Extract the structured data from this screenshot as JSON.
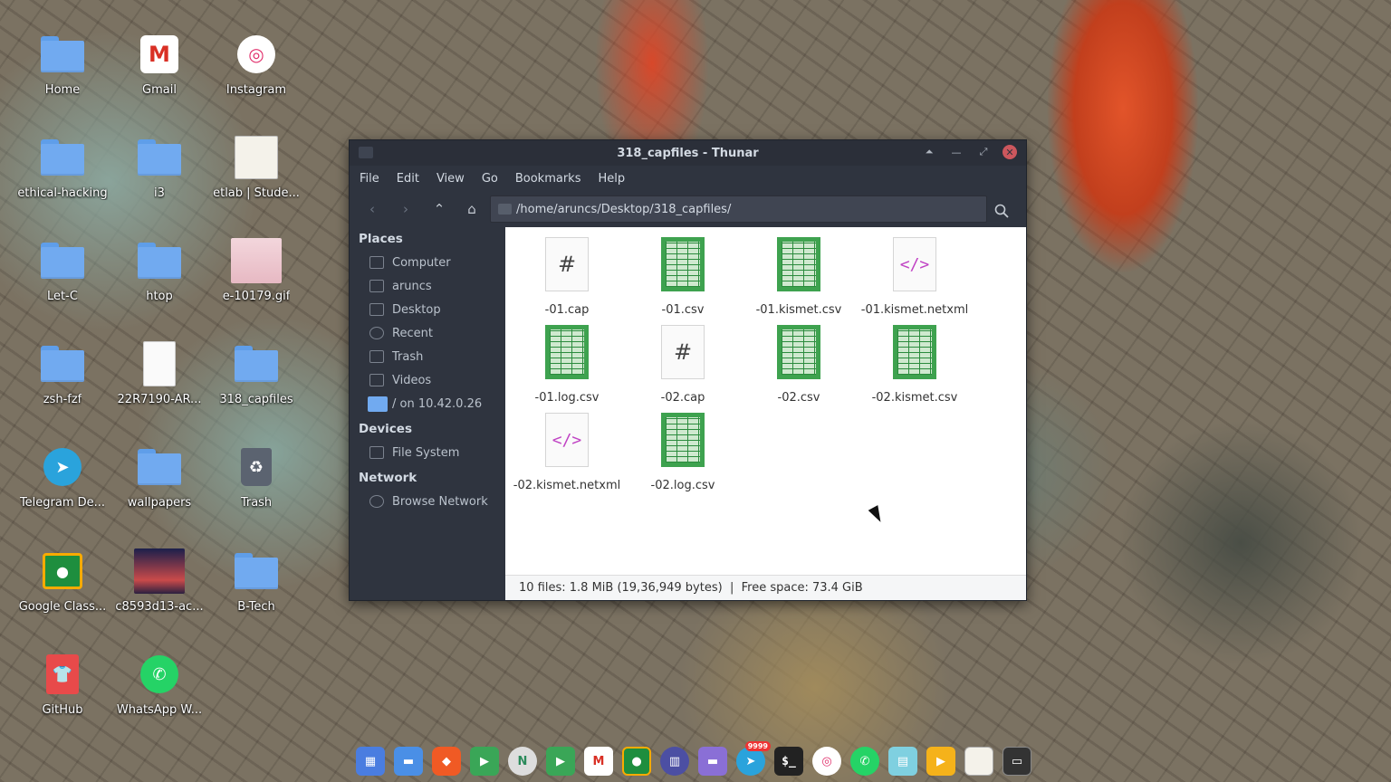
{
  "desktop": {
    "icons": [
      {
        "label": "Home"
      },
      {
        "label": "Gmail"
      },
      {
        "label": "Instagram"
      },
      {
        "label": "ethical-hacking"
      },
      {
        "label": "i3"
      },
      {
        "label": "etlab | Stude..."
      },
      {
        "label": "Let-C"
      },
      {
        "label": "htop"
      },
      {
        "label": "e-10179.gif"
      },
      {
        "label": "zsh-fzf"
      },
      {
        "label": "22R7190-AR..."
      },
      {
        "label": "318_capfiles"
      },
      {
        "label": "Telegram De..."
      },
      {
        "label": "wallpapers"
      },
      {
        "label": "Trash"
      },
      {
        "label": "Google Class..."
      },
      {
        "label": "c8593d13-ac..."
      },
      {
        "label": "B-Tech"
      },
      {
        "label": "GitHub"
      },
      {
        "label": "WhatsApp W..."
      }
    ]
  },
  "window": {
    "title": "318_capfiles - Thunar",
    "menu": [
      "File",
      "Edit",
      "View",
      "Go",
      "Bookmarks",
      "Help"
    ],
    "path": "/home/aruncs/Desktop/318_capfiles/",
    "sidebar": {
      "places_header": "Places",
      "places": [
        {
          "label": "Computer",
          "icon": "computer-icon"
        },
        {
          "label": "aruncs",
          "icon": "home-icon"
        },
        {
          "label": "Desktop",
          "icon": "desktop-icon"
        },
        {
          "label": "Recent",
          "icon": "recent-icon"
        },
        {
          "label": "Trash",
          "icon": "trash-icon"
        },
        {
          "label": "Videos",
          "icon": "videos-icon"
        },
        {
          "label": "/ on 10.42.0.26",
          "icon": "network-folder-icon"
        }
      ],
      "devices_header": "Devices",
      "devices": [
        {
          "label": "File System",
          "icon": "drive-icon"
        }
      ],
      "network_header": "Network",
      "network": [
        {
          "label": "Browse Network",
          "icon": "network-icon"
        }
      ]
    },
    "files": [
      {
        "name": "-01.cap",
        "type": "binary"
      },
      {
        "name": "-01.csv",
        "type": "spreadsheet"
      },
      {
        "name": "-01.kismet.csv",
        "type": "spreadsheet"
      },
      {
        "name": "-01.kismet.netxml",
        "type": "xml"
      },
      {
        "name": "-01.log.csv",
        "type": "spreadsheet"
      },
      {
        "name": "-02.cap",
        "type": "binary"
      },
      {
        "name": "-02.csv",
        "type": "spreadsheet"
      },
      {
        "name": "-02.kismet.csv",
        "type": "spreadsheet"
      },
      {
        "name": "-02.kismet.netxml",
        "type": "xml"
      },
      {
        "name": "-02.log.csv",
        "type": "spreadsheet"
      }
    ],
    "status": "10 files: 1.8 MiB (19,36,949 bytes)  |  Free space: 73.4 GiB"
  },
  "dock": {
    "telegram_badge": "9999",
    "terminal_glyph": "$_"
  },
  "colors": {
    "accent_close": "#cc575d",
    "window_bg": "#2f343f",
    "folder_blue": "#71aaf0",
    "sheet_green": "#3ea24f",
    "xml_magenta": "#c043c4"
  }
}
